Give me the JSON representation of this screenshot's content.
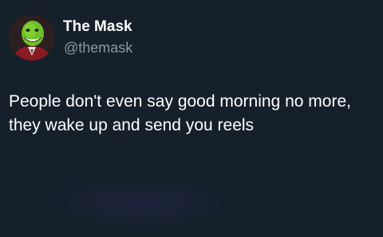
{
  "author": {
    "display_name": "The Mask",
    "handle": "@themask",
    "avatar_icon": "mask-character-avatar"
  },
  "tweet": {
    "text_line_1": "People don't even say good morning no more,",
    "text_line_2": "they wake up and send you reels"
  },
  "colors": {
    "background": "#16202b",
    "primary_text": "#ffffff",
    "secondary_text": "#8b98a5"
  }
}
